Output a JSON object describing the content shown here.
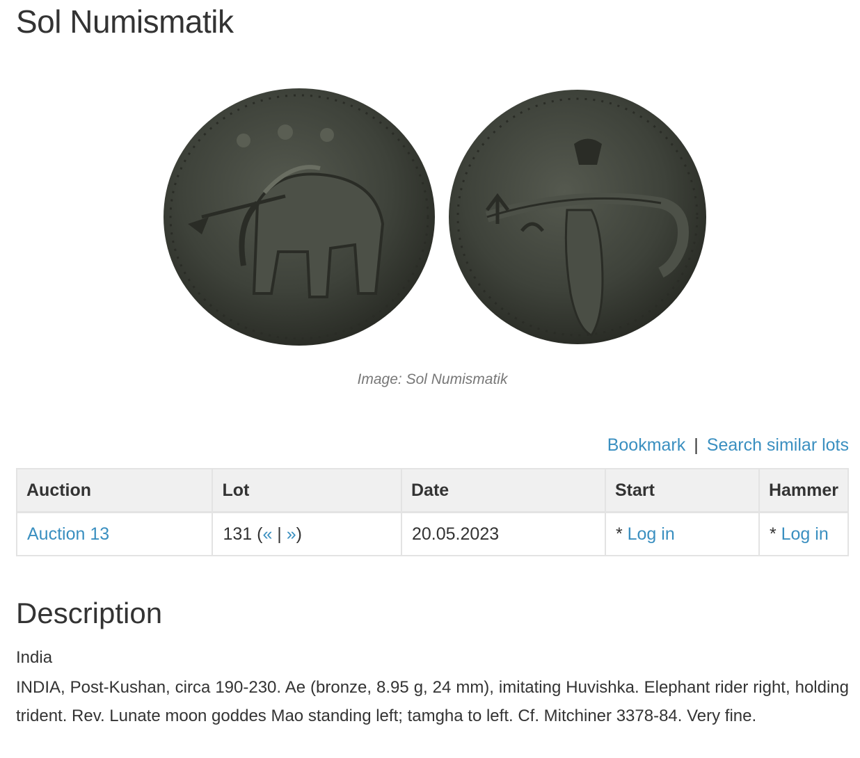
{
  "page": {
    "title": "Sol Numismatik",
    "image_caption": "Image: Sol Numismatik"
  },
  "actions": {
    "bookmark_label": "Bookmark",
    "separator": "|",
    "search_similar_label": "Search similar lots"
  },
  "table": {
    "headers": [
      "Auction",
      "Lot",
      "Date",
      "Start",
      "Hammer"
    ],
    "row": {
      "auction": "Auction 13",
      "lot_number": "131",
      "lot_open_paren": " (",
      "prev_label": "«",
      "nav_separator": " | ",
      "next_label": "»",
      "lot_close_paren": ")",
      "date": "20.05.2023",
      "start_prefix": "* ",
      "start_link": "Log in",
      "hammer_prefix": "* ",
      "hammer_link": "Log in"
    }
  },
  "description": {
    "heading": "Description",
    "country": "India",
    "text": "INDIA, Post-Kushan, circa 190-230. Ae (bronze, 8.95 g, 24 mm), imitating Huvishka. Elephant rider right, holding trident. Rev. Lunate moon goddes Mao standing left; tamgha to left. Cf. Mitchiner 3378-84. Very fine."
  },
  "colors": {
    "link": "#3a8fc0",
    "text": "#333333",
    "header_bg": "#f0f0f0",
    "coin_bronze": "#3e423a"
  }
}
